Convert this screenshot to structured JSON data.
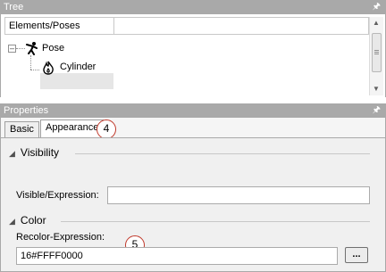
{
  "tree": {
    "title": "Tree",
    "pin_icon": "pin-icon",
    "column_header": "Elements/Poses",
    "items": [
      {
        "label": "Pose",
        "icon": "pose-figure-icon",
        "expanded": true
      },
      {
        "label": "Cylinder",
        "icon": "flame-shape-icon",
        "selected": true
      }
    ]
  },
  "properties": {
    "title": "Properties",
    "pin_icon": "pin-icon",
    "tabs": [
      {
        "label": "Basic",
        "active": false
      },
      {
        "label": "Appearance",
        "active": true
      }
    ],
    "sections": [
      {
        "title": "Visibility",
        "fields": [
          {
            "label": "Visible/Expression:",
            "value": ""
          }
        ]
      },
      {
        "title": "Color",
        "fields": [
          {
            "label": "Recolor-Expression:",
            "value": "16#FFFF0000"
          }
        ],
        "button_label": "..."
      }
    ]
  },
  "callouts": [
    "4",
    "5"
  ],
  "colors": {
    "callout_border": "#c0392b",
    "title_bar": "#a9a9a9"
  }
}
